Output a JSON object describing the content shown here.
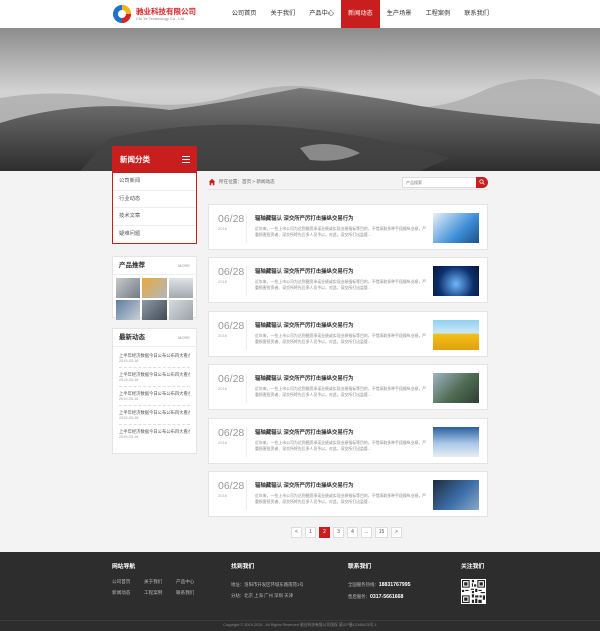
{
  "header": {
    "company_name": "驰业科技有限公司",
    "company_sub": "Chi Ye Technology Co., Ltd.",
    "nav": [
      "公司首页",
      "关于我们",
      "产品中心",
      "新闻动态",
      "生产场景",
      "工程案例",
      "联系我们"
    ],
    "active_nav": "新闻动态",
    "accent": "#c81e1e"
  },
  "sidebar": {
    "cat_title": "新闻分类",
    "categories": [
      "公司新闻",
      "行业动态",
      "技术文章",
      "疑难问题"
    ],
    "products_title": "产品推荐",
    "more": "MORE",
    "news_title": "最新动态",
    "news": [
      {
        "title": "上半年经济数据今日公布公布四大看点",
        "date": "2019-03-16"
      },
      {
        "title": "上半年经济数据今日公布公布四大看点",
        "date": "2019-03-16"
      },
      {
        "title": "上半年经济数据今日公布公布四大看点",
        "date": "2019-03-16"
      },
      {
        "title": "上半年经济数据今日公布公布四大看点",
        "date": "2019-03-16"
      },
      {
        "title": "上半年经济数据今日公布公布四大看点",
        "date": "2019-03-16"
      }
    ]
  },
  "breadcrumb": "所在位置：首页 > 新闻动态",
  "search": {
    "placeholder": "产品搜索"
  },
  "articles": [
    {
      "day": "06/28",
      "year": "2018",
      "title": "辐轴藏辐认 深交所严厉打击操纵交易行为",
      "desc": "近年来，一些上市公司为达到圈资承诺业绩或实现业绩指标等目的，不惜采取多种手段操纵业绩，严重损害投资者、深交所将先后多人员予以，对此，深交所打出监管…"
    },
    {
      "day": "06/28",
      "year": "2018",
      "title": "辐轴藏辐认 深交所严厉打击操纵交易行为",
      "desc": "近年来，一些上市公司为达到圈资承诺业绩或实现业绩指标等目的，不惜采取多种手段操纵业绩，严重损害投资者、深交所将先后多人员予以，对此，深交所打出监管…"
    },
    {
      "day": "06/28",
      "year": "2018",
      "title": "辐轴藏辐认 深交所严厉打击操纵交易行为",
      "desc": "近年来，一些上市公司为达到圈资承诺业绩或实现业绩指标等目的，不惜采取多种手段操纵业绩，严重损害投资者、深交所将先后多人员予以，对此，深交所打出监管…"
    },
    {
      "day": "06/28",
      "year": "2018",
      "title": "辐轴藏辐认 深交所严厉打击操纵交易行为",
      "desc": "近年来，一些上市公司为达到圈资承诺业绩或实现业绩指标等目的，不惜采取多种手段操纵业绩，严重损害投资者、深交所将先后多人员予以，对此，深交所打出监管…"
    },
    {
      "day": "06/28",
      "year": "2018",
      "title": "辐轴藏辐认 深交所严厉打击操纵交易行为",
      "desc": "近年来，一些上市公司为达到圈资承诺业绩或实现业绩指标等目的，不惜采取多种手段操纵业绩，严重损害投资者、深交所将先后多人员予以，对此，深交所打出监管…"
    },
    {
      "day": "06/28",
      "year": "2018",
      "title": "辐轴藏辐认 深交所严厉打击操纵交易行为",
      "desc": "近年来，一些上市公司为达到圈资承诺业绩或实现业绩指标等目的，不惜采取多种手段操纵业绩，严重损害投资者、深交所将先后多人员予以，对此，深交所打出监管…"
    }
  ],
  "pagination": {
    "prev": "<",
    "pages": [
      "1",
      "2",
      "3",
      "4",
      "...",
      "15"
    ],
    "current": "2",
    "next": ">"
  },
  "footer": {
    "nav_title": "网站导航",
    "nav_links": [
      "公司首页",
      "关于我们",
      "产品中心",
      "新闻动态",
      "工程案例",
      "联系我们"
    ],
    "find_title": "找到我们",
    "address": "地址：洛阳市开发区环城东路南苑1号",
    "branches": "分站：北京  上海  广州  深圳  天津",
    "contact_title": "联系我们",
    "hotline_label": "全国服务热线：",
    "hotline": "18831767995",
    "service_label": "售后服务：",
    "service": "0317-5661668",
    "follow_title": "关注我们",
    "copyright": "Copyright © 2019-2026 . All Rights Reserved  驰业科技有限公司版权 冀ICP备12345678号-1"
  }
}
